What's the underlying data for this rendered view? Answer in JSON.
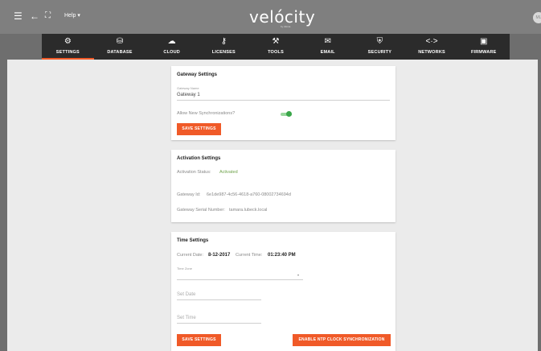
{
  "topbar": {
    "help_label": "Help ▾",
    "logo_text": "velócity",
    "logo_sub": "by Atlona",
    "avatar_text": "ML"
  },
  "nav": {
    "tabs": [
      {
        "label": "SETTINGS",
        "icon": "gear-icon",
        "glyph": "⚙",
        "active": true
      },
      {
        "label": "DATABASE",
        "icon": "database-icon",
        "glyph": "⛁",
        "active": false
      },
      {
        "label": "CLOUD",
        "icon": "cloud-icon",
        "glyph": "☁",
        "active": false
      },
      {
        "label": "LICENSES",
        "icon": "key-icon",
        "glyph": "⚷",
        "active": false
      },
      {
        "label": "TOOLS",
        "icon": "wrench-icon",
        "glyph": "⚒",
        "active": false
      },
      {
        "label": "EMAIL",
        "icon": "email-icon",
        "glyph": "✉",
        "active": false
      },
      {
        "label": "SECURITY",
        "icon": "shield-icon",
        "glyph": "⛨",
        "active": false
      },
      {
        "label": "NETWORKS",
        "icon": "code-arrows-icon",
        "glyph": "<·>",
        "active": false
      },
      {
        "label": "FIRMWARE",
        "icon": "chip-icon",
        "glyph": "▣",
        "active": false
      }
    ],
    "accent_color": "#f05a28"
  },
  "gateway_settings": {
    "title": "Gateway Settings",
    "name_label": "Gateway Name",
    "name_value": "Gateway 1",
    "allow_sync_label": "Allow New Synchronizations?",
    "allow_sync_on": true,
    "save_label": "SAVE SETTINGS"
  },
  "activation_settings": {
    "title": "Activation Settings",
    "status_label": "Activation Status:",
    "status_value": "Activated",
    "gateway_id_label": "Gateway Id:",
    "gateway_id_value": "6e1de987-4c56-4618-a760-08002734694d",
    "serial_label": "Gateway Serial Number:",
    "serial_value": "tamara.lubeck.local"
  },
  "time_settings": {
    "title": "Time Settings",
    "current_date_label": "Current Date:",
    "current_date_value": "8-12-2017",
    "current_time_label": "Current Time:",
    "current_time_value": "01:23:40 PM",
    "time_zone_label": "Time Zone",
    "time_zone_value": "",
    "set_date_placeholder": "Set Date",
    "set_time_placeholder": "Set Time",
    "save_label": "SAVE SETTINGS",
    "ntp_label": "ENABLE NTP CLOCK SYNCHRONIZATION"
  }
}
